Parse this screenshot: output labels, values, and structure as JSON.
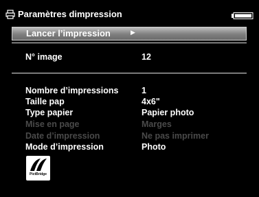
{
  "header": {
    "title": "Paramètres dimpression",
    "icon": "printer-icon",
    "battery_icon": "battery-icon"
  },
  "menu": {
    "selected_item": "Lancer l’impression"
  },
  "image": {
    "label": "N° image",
    "value": "12"
  },
  "settings": [
    {
      "label": "Nombre d’impressions",
      "value": "1",
      "enabled": true
    },
    {
      "label": "Taille pap",
      "value": "4x6\"",
      "enabled": true
    },
    {
      "label": "Type papier",
      "value": "Papier photo",
      "enabled": true
    },
    {
      "label": "Mise en page",
      "value": "Marges",
      "enabled": false
    },
    {
      "label": "Date d’impression",
      "value": "Ne pas imprimer",
      "enabled": false
    },
    {
      "label": "Mode d’impression",
      "value": "Photo",
      "enabled": true
    }
  ],
  "logo": {
    "text": "PictBridge"
  },
  "colors": {
    "background": "#000000",
    "text": "#ffffff",
    "disabled_text": "#4a4a4a",
    "selection": "#8a8a8a"
  }
}
